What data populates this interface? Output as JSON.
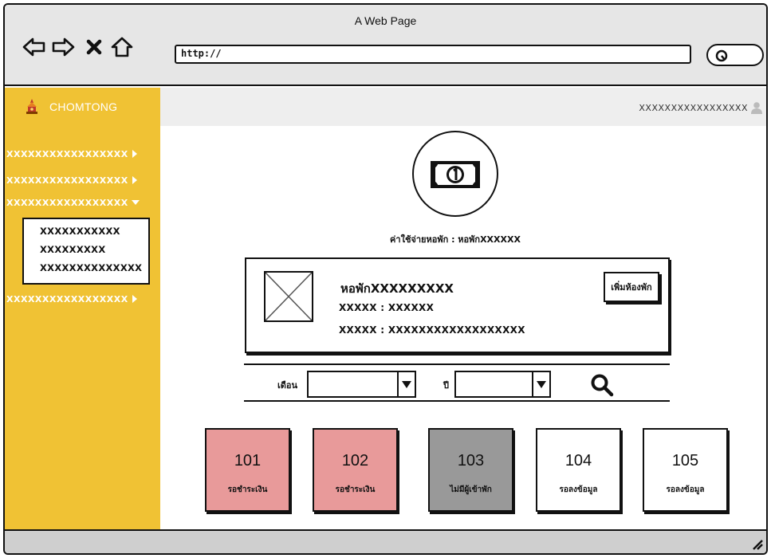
{
  "browser": {
    "window_title": "A Web Page",
    "url": "http://",
    "nav_icons": [
      "back-arrow-icon",
      "forward-arrow-icon",
      "close-x-icon",
      "home-icon"
    ],
    "search_icon": "search-icon"
  },
  "header": {
    "brand": "CHOMTONG",
    "user_name": "XXXXXXXXXXXXXXXXX",
    "user_icon": "user-icon"
  },
  "sidebar": {
    "items": [
      {
        "label": "XXXXXXXXXXXXXXXXX"
      },
      {
        "label": "XXXXXXXXXXXXXXXXX"
      },
      {
        "label": "XXXXXXXXXXXXXXXXX"
      },
      {
        "label": "XXXXXXXXXXXXXXXXX"
      }
    ],
    "submenu": [
      "XXXXXXXXXXX",
      "XXXXXXXXX",
      "XXXXXXXXXXXXXX"
    ]
  },
  "main": {
    "expense_label": "ค่าใช้จ่ายหอพัก : หอพักXXXXXX",
    "dorm": {
      "name": "หอพักXXXXXXXXX",
      "line1": "XXXXX : XXXXXX",
      "line2": "XXXXX : XXXXXXXXXXXXXXXXXX",
      "add_room_button": "เพิ่มห้องพัก"
    },
    "filter": {
      "month_label": "เดือน",
      "year_label": "ปี",
      "month_value": "",
      "year_value": ""
    },
    "rooms": [
      {
        "number": "101",
        "status": "รอชำระเงิน",
        "color": "#e89a9a"
      },
      {
        "number": "102",
        "status": "รอชำระเงิน",
        "color": "#e89a9a"
      },
      {
        "number": "103",
        "status": "ไม่มีผู้เข้าพัก",
        "color": "#999999"
      },
      {
        "number": "104",
        "status": "รอลงข้อมูล",
        "color": "#ffffff"
      },
      {
        "number": "105",
        "status": "รอลงข้อมูล",
        "color": "#ffffff"
      }
    ]
  },
  "colors": {
    "sidebar": "#f0c234",
    "chrome": "#e6e6e6",
    "pending_payment": "#e89a9a",
    "vacant": "#999999"
  }
}
